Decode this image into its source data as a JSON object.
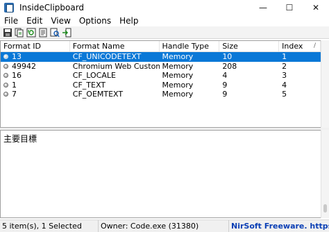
{
  "window": {
    "title": "InsideClipboard",
    "minimize": "—",
    "maximize": "☐",
    "close": "✕"
  },
  "menu": [
    "File",
    "Edit",
    "View",
    "Options",
    "Help"
  ],
  "toolbar": {
    "icons": [
      "save-icon",
      "copy-icon",
      "refresh-icon",
      "properties-icon",
      "find-icon",
      "exit-icon"
    ]
  },
  "table": {
    "headers": [
      "Format ID",
      "Format Name",
      "Handle Type",
      "Size",
      "Index"
    ],
    "sort_indicator": "/",
    "rows": [
      {
        "id": "13",
        "name": "CF_UNICODETEXT",
        "handle": "Memory",
        "size": "10",
        "index": "1"
      },
      {
        "id": "49942",
        "name": "Chromium Web Custom MI...",
        "handle": "Memory",
        "size": "208",
        "index": "2"
      },
      {
        "id": "16",
        "name": "CF_LOCALE",
        "handle": "Memory",
        "size": "4",
        "index": "3"
      },
      {
        "id": "1",
        "name": "CF_TEXT",
        "handle": "Memory",
        "size": "9",
        "index": "4"
      },
      {
        "id": "7",
        "name": "CF_OEMTEXT",
        "handle": "Memory",
        "size": "9",
        "index": "5"
      }
    ],
    "selected_index": 0
  },
  "content": {
    "text": "主要目標"
  },
  "status": {
    "items": "5 item(s), 1 Selected",
    "owner": "Owner: Code.exe (31380)",
    "link": "NirSoft Freeware. https://w"
  },
  "colors": {
    "selection": "#0a78d7",
    "link": "#0a3fb5"
  }
}
